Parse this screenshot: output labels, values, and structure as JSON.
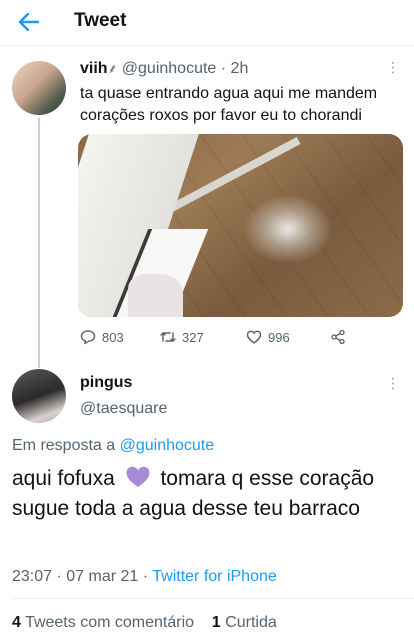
{
  "header": {
    "title": "Tweet",
    "back_icon": "arrow-left-icon",
    "accent": "#1d9bf0"
  },
  "tweet1": {
    "name": "viih",
    "name_suffix": "⸙",
    "handle": "@guinhocute",
    "time": "2h",
    "text": "ta quase entrando agua aqui me mandem corações roxos por favor eu to chorandi",
    "actions": {
      "replies": "803",
      "retweets": "327",
      "likes": "996"
    }
  },
  "tweet2": {
    "name": "pingus",
    "handle": "@taesquare",
    "replying_prefix": "Em resposta a",
    "replying_to": "@guinhocute",
    "text_before_emoji": "aqui fofuxa",
    "text_after_emoji": "tomara q esse coração sugue toda a agua desse teu barraco",
    "emoji": "purple-heart-icon",
    "emoji_color": "#a78bd8",
    "time": "23:07",
    "date": "07 mar 21",
    "source": "Twitter for iPhone",
    "stats": {
      "quote_count": "4",
      "quote_label": "Tweets com comentário",
      "like_count": "1",
      "like_label": "Curtida"
    }
  }
}
